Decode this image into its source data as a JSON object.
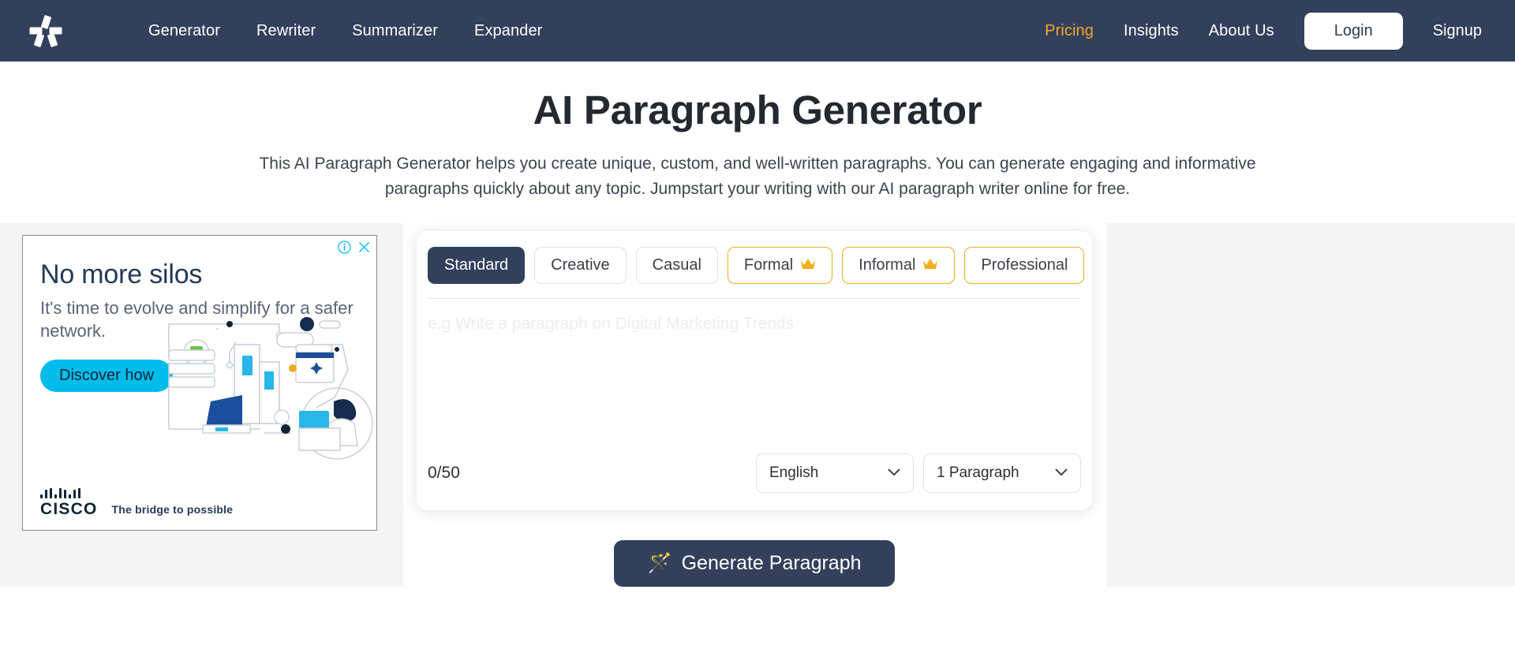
{
  "navbar": {
    "logo_icon": "pinwheel-logo-icon",
    "links": [
      {
        "label": "Generator"
      },
      {
        "label": "Rewriter"
      },
      {
        "label": "Summarizer"
      },
      {
        "label": "Expander"
      }
    ],
    "right_links": [
      {
        "label": "Pricing",
        "color": "#f5a623"
      },
      {
        "label": "Insights",
        "color": "#ffffff"
      },
      {
        "label": "About Us",
        "color": "#ffffff"
      }
    ],
    "login_label": "Login",
    "signup_label": "Signup",
    "background": "#32405c"
  },
  "hero": {
    "title": "AI Paragraph Generator",
    "description": "This AI Paragraph Generator helps you create unique, custom, and well-written paragraphs. You can generate engaging and informative paragraphs quickly about any topic. Jumpstart your writing with our AI paragraph writer online for free."
  },
  "ad": {
    "info_icon": "info-circle-icon",
    "close_icon": "close-icon",
    "headline": "No more silos",
    "subtext": "It's time to evolve and simplify for a safer network.",
    "cta_label": "Discover how",
    "brand": "CISCO",
    "tagline": "The bridge to possible",
    "accent": "#00bceb"
  },
  "generator": {
    "tones": [
      {
        "label": "Standard",
        "active": true,
        "premium": false
      },
      {
        "label": "Creative",
        "active": false,
        "premium": false
      },
      {
        "label": "Casual",
        "active": false,
        "premium": false
      },
      {
        "label": "Formal",
        "active": false,
        "premium": true
      },
      {
        "label": "Informal",
        "active": false,
        "premium": true
      },
      {
        "label": "Professional",
        "active": false,
        "premium": true
      }
    ],
    "crown_icon": "crown-icon",
    "prompt_placeholder": "e.g Write a paragraph on Digital Marketing Trends",
    "prompt_value": "",
    "counter": "0/50",
    "language_select": {
      "value": "English",
      "chevron_icon": "chevron-down-icon"
    },
    "length_select": {
      "value": "1 Paragraph",
      "chevron_icon": "chevron-down-icon"
    },
    "generate_label": "Generate Paragraph",
    "generate_icon": "magic-wand-icon",
    "accent_dark": "#32405c",
    "accent_premium": "#f0ad1e"
  }
}
